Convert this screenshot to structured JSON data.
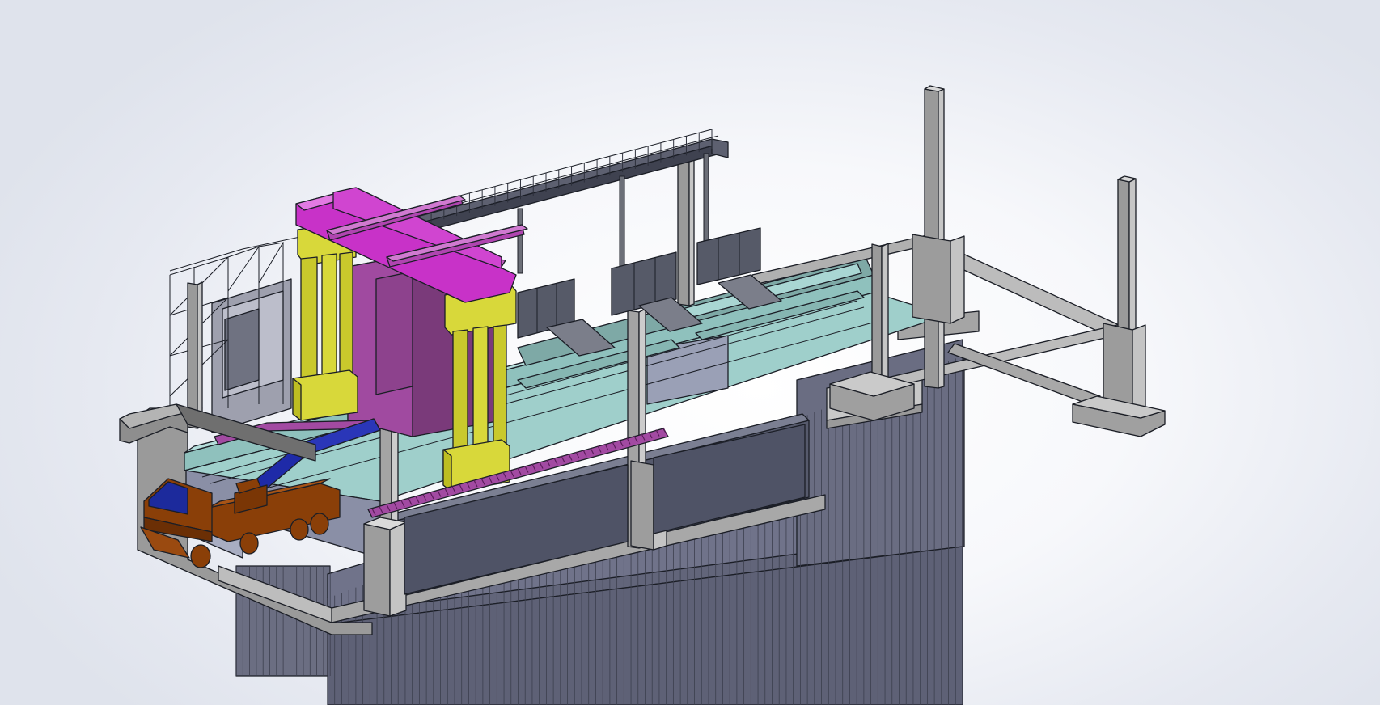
{
  "viewport": {
    "background": "#eceef4",
    "colors": {
      "concrete": "#b4b4b4",
      "concrete_dark": "#8c8c8c",
      "sheet_pile": "#6e7084",
      "trench_wall": "#54586a",
      "water": "#9fcfcb",
      "clamp_frame": "#c832c8",
      "column_body": "#d8d83a",
      "grab_bucket": "#7a3a7a",
      "conveyor_arm": "#1e2aa8",
      "truck_body": "#8a3f08",
      "truck_cab": "#1c2a9c",
      "catwalk": "#6c6f78"
    },
    "icons": [
      "sheet-pile-wall",
      "concrete-guide-wall",
      "slurry-trench",
      "trench-cutter-machine",
      "excavation-conveyor",
      "dump-truck",
      "overhead-catwalk",
      "steel-scaffold-tower",
      "concrete-columns"
    ]
  }
}
